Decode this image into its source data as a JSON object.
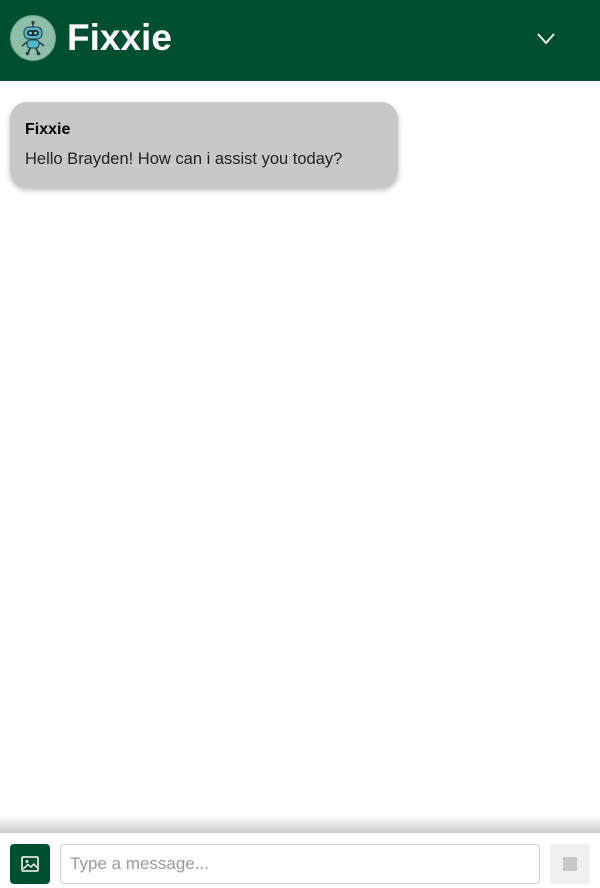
{
  "header": {
    "title": "Fixxie",
    "avatar_icon": "robot-icon",
    "collapse_icon": "chevron-down-icon",
    "background_color": "#005030"
  },
  "messages": [
    {
      "sender": "Fixxie",
      "text": "Hello Brayden! How can i assist you today?"
    }
  ],
  "composer": {
    "image_button_icon": "image-icon",
    "input_placeholder": "Type a message...",
    "input_value": "",
    "send_button_icon": "send-icon",
    "send_enabled": false
  },
  "colors": {
    "brand": "#005030",
    "bubble": "#c8c8c8"
  }
}
